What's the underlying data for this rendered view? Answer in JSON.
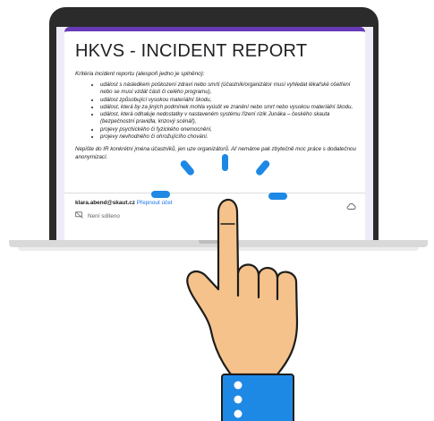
{
  "form": {
    "title": "HKVS - INCIDENT REPORT",
    "intro": "Kritéria incident reportu (alespoň jedno je splněno):",
    "criteria": [
      "událost s následkem poškození zdraví nebo smrti (účastník/organizátor musí vyhledat lékařské ošetření nebo se musí vzdát části či celého programu),",
      "událost způsobující vysokou materiální škodu,",
      "událost, která by za jiných podmínek mohla vyústit ve zranění nebo smrt nebo vysokou materiální škodu,",
      "událost, která odhaluje nedostatky v nastaveném systému řízení rizik Junáka – českého skauta (bezpečnostní pravidla, krizový scénář),",
      "projevy psychického či fyzického onemocnění,",
      "projevy nevhodného či ohrožujícího chování."
    ],
    "note": "Nepište do IR konkrétní jména účastníků, jen uze organizátorů. Ať nemáme pak zbytečně moc práce s dodatečnou anonymizací.",
    "account_email": "klara.abend@skaut.cz",
    "switch_account": "Přepnout účet",
    "not_shared": "Není sdíleno"
  },
  "colors": {
    "form_accent": "#673ab7",
    "laptop": "#2b2b2b",
    "hand_fill": "#f6c28b",
    "hand_outline": "#1d1d1b",
    "sleeve": "#1e88e5",
    "tap_marks": "#1e88e5"
  }
}
